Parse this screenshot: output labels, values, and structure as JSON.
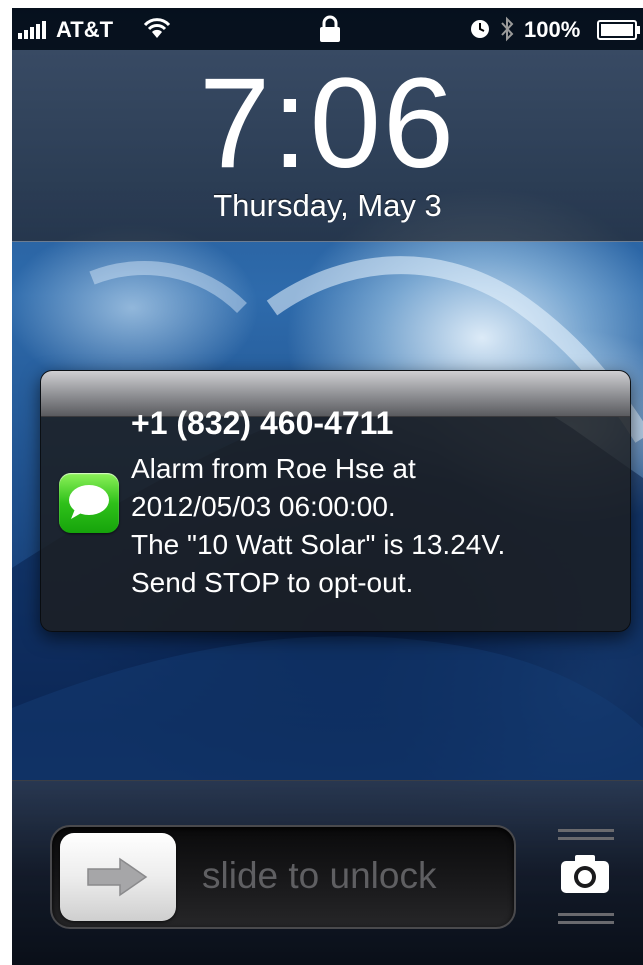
{
  "status_bar": {
    "carrier": "AT&T",
    "battery_percent": "100%",
    "icons": [
      "signal-icon",
      "wifi-icon",
      "lock-icon",
      "alarm-icon",
      "bluetooth-icon",
      "battery-icon"
    ]
  },
  "lock_screen": {
    "time": "7:06",
    "date": "Thursday, May 3"
  },
  "notification": {
    "app_icon": "messages-icon",
    "sender": "+1 (832) 460-4711",
    "message_lines": [
      "Alarm from Roe Hse at",
      "2012/05/03 06:00:00.",
      "The \"10 Watt Solar\" is 13.24V.",
      "Send STOP to opt-out."
    ]
  },
  "unlock": {
    "slider_label": "slide to unlock",
    "knob_icon": "arrow-right-icon",
    "camera_icon": "camera-icon"
  },
  "colors": {
    "messages_green": "#2fc11a",
    "wallpaper_blue": "#2e6bac"
  }
}
